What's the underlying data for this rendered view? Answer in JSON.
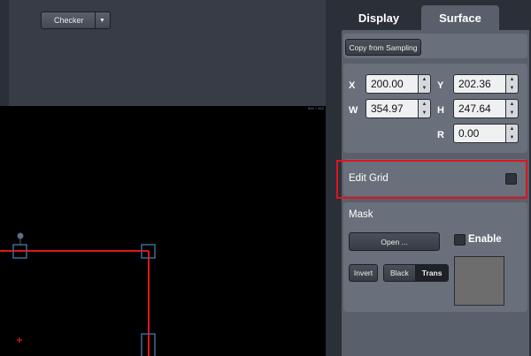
{
  "viewer": {
    "background_mode": "Checker",
    "resolution_label": "800 × 600"
  },
  "tabs": [
    {
      "label": "Display",
      "active": false
    },
    {
      "label": "Surface",
      "active": true
    }
  ],
  "surface": {
    "copy_button": "Copy from Sampling",
    "x": {
      "label": "X",
      "value": "200.00"
    },
    "y": {
      "label": "Y",
      "value": "202.36"
    },
    "w": {
      "label": "W",
      "value": "354.97"
    },
    "h": {
      "label": "H",
      "value": "247.64"
    },
    "r": {
      "label": "R",
      "value": "0.00"
    },
    "edit_grid": {
      "label": "Edit Grid",
      "checked": false
    }
  },
  "mask": {
    "title": "Mask",
    "open_button": "Open ...",
    "enable_label": "Enable",
    "enable_checked": false,
    "invert_button": "Invert",
    "black_label": "Black",
    "trans_label": "Trans",
    "selected_mode": "Trans"
  },
  "colors": {
    "grid_line": "#e0141e",
    "handle": "#3f6a92",
    "highlight": "#e0141e",
    "panel": "#5a606b"
  }
}
